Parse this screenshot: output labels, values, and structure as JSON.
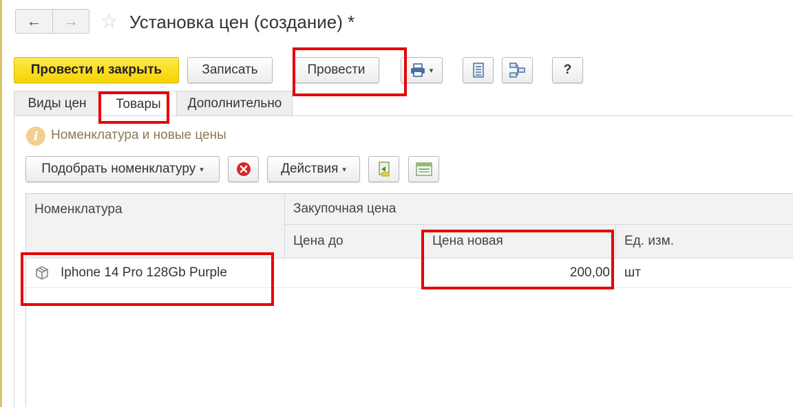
{
  "window": {
    "title": "Установка цен (создание) *"
  },
  "nav": {
    "back": "←",
    "forward": "→",
    "favorite": "☆"
  },
  "toolbar": {
    "post_close": "Провести и закрыть",
    "save": "Записать",
    "post": "Провести",
    "help": "?"
  },
  "tabs": [
    {
      "label": "Виды цен",
      "active": false
    },
    {
      "label": "Товары",
      "active": true
    },
    {
      "label": "Дополнительно",
      "active": false
    }
  ],
  "info": {
    "text": "Номенклатура и новые цены"
  },
  "table_toolbar": {
    "pick": "Подобрать номенклатуру",
    "actions": "Действия"
  },
  "table": {
    "columns": {
      "item": "Номенклатура",
      "purchase_price": "Закупочная цена",
      "price_before": "Цена до",
      "price_new": "Цена новая",
      "unit": "Ед. изм."
    },
    "rows": [
      {
        "item": "Iphone 14 Pro 128Gb Purple",
        "price_before": "",
        "price_new": "200,00",
        "unit": "шт"
      }
    ]
  },
  "colors": {
    "primary_button": "#f5d400",
    "highlight": "#e60000",
    "info_icon": "#f3cf8e"
  }
}
